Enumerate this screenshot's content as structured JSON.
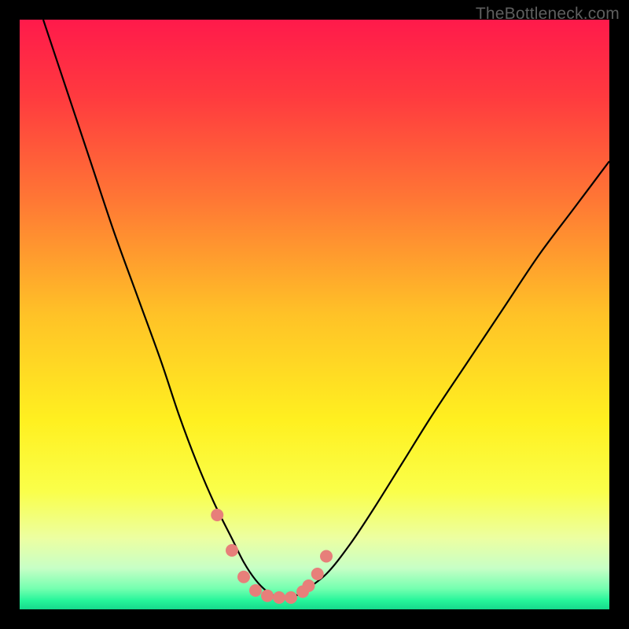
{
  "watermark": "TheBottleneck.com",
  "colors": {
    "background": "#000000",
    "curve": "#000000",
    "dots": "#e77f7a",
    "gradient_stops": [
      {
        "offset": 0.0,
        "color": "#ff1a4b"
      },
      {
        "offset": 0.13,
        "color": "#ff3a3f"
      },
      {
        "offset": 0.3,
        "color": "#ff7535"
      },
      {
        "offset": 0.5,
        "color": "#ffc227"
      },
      {
        "offset": 0.68,
        "color": "#fff020"
      },
      {
        "offset": 0.8,
        "color": "#faff4a"
      },
      {
        "offset": 0.88,
        "color": "#ecffa2"
      },
      {
        "offset": 0.93,
        "color": "#c7ffc6"
      },
      {
        "offset": 0.965,
        "color": "#74ffb0"
      },
      {
        "offset": 0.985,
        "color": "#26f59a"
      },
      {
        "offset": 1.0,
        "color": "#16d98c"
      }
    ]
  },
  "chart_data": {
    "type": "line",
    "title": "",
    "xlabel": "",
    "ylabel": "",
    "xlim": [
      0,
      100
    ],
    "ylim": [
      0,
      100
    ],
    "series": [
      {
        "name": "bottleneck-curve",
        "x": [
          4,
          8,
          12,
          16,
          20,
          24,
          27,
          30,
          33,
          36,
          38,
          40,
          42,
          44,
          46,
          48,
          52,
          56,
          60,
          65,
          70,
          76,
          82,
          88,
          94,
          100
        ],
        "y": [
          100,
          88,
          76,
          64,
          53,
          42,
          33,
          25,
          18,
          12,
          8,
          5,
          3,
          2,
          2,
          3,
          6,
          11,
          17,
          25,
          33,
          42,
          51,
          60,
          68,
          76
        ]
      }
    ],
    "dots": {
      "name": "highlighted-points",
      "x": [
        33.5,
        36,
        38,
        40,
        42,
        44,
        46,
        48,
        49,
        50.5,
        52
      ],
      "y": [
        16,
        10,
        5.5,
        3.2,
        2.3,
        2.0,
        2.0,
        3.0,
        4.0,
        6.0,
        9.0
      ],
      "radius": 8
    }
  }
}
